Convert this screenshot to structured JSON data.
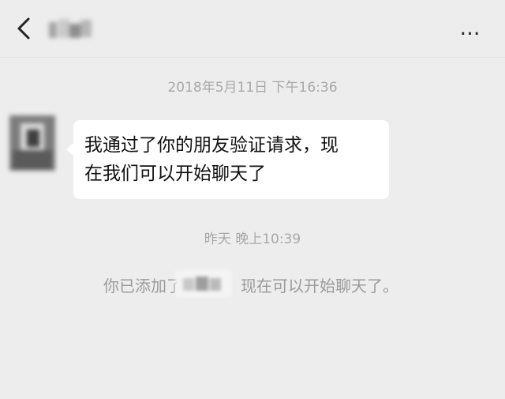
{
  "header": {
    "back_icon": "chevron-left-icon",
    "more_icon": "more-dots-icon",
    "more_label": "…"
  },
  "messages": {
    "timestamp_1": "2018年5月11日 下午16:36",
    "bubble_text": "我通过了你的朋友验证请求，现\n在我们可以开始聊天了",
    "timestamp_2": "昨天 晚上10:39",
    "system_before": "你已添加了",
    "system_after": "现在可以开始聊天了。"
  },
  "colors": {
    "background": "#ededed",
    "bubble": "#ffffff",
    "timestamp": "#a8a8a8",
    "system_text": "#9a9a9a"
  }
}
